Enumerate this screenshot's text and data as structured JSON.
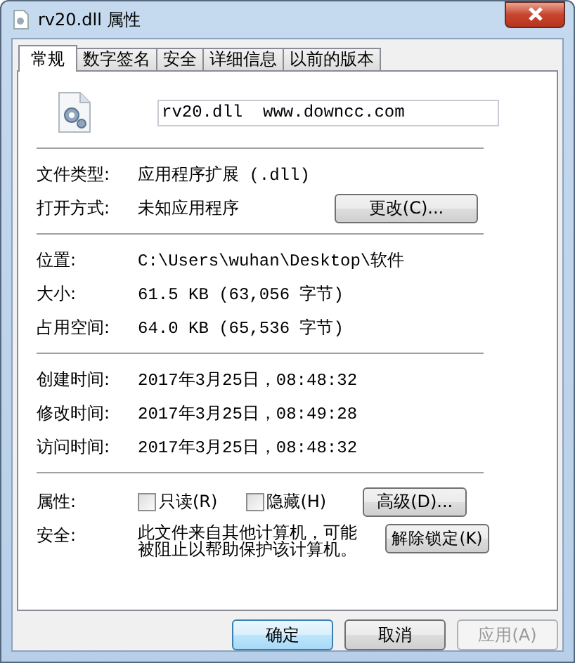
{
  "window": {
    "title": "rv20.dll 属性"
  },
  "tabs": [
    {
      "label": "常规",
      "selected": true
    },
    {
      "label": "数字签名",
      "selected": false
    },
    {
      "label": "安全",
      "selected": false
    },
    {
      "label": "详细信息",
      "selected": false
    },
    {
      "label": "以前的版本",
      "selected": false
    }
  ],
  "file_name": {
    "value": "rv20.dll  www.downcc.com"
  },
  "sections": [
    [
      {
        "label": "文件类型:",
        "value": "应用程序扩展 (.dll)"
      },
      {
        "label": "打开方式:",
        "value": "未知应用程序",
        "button": "更改(C)..."
      }
    ],
    [
      {
        "label": "位置:",
        "value": "C:\\Users\\wuhan\\Desktop\\软件"
      },
      {
        "label": "大小:",
        "value": "61.5 KB (63,056 字节)"
      },
      {
        "label": "占用空间:",
        "value": "64.0 KB (65,536 字节)"
      }
    ],
    [
      {
        "label": "创建时间:",
        "value": "2017年3月25日，08:48:32"
      },
      {
        "label": "修改时间:",
        "value": "2017年3月25日，08:49:28"
      },
      {
        "label": "访问时间:",
        "value": "2017年3月25日，08:48:32"
      }
    ]
  ],
  "attributes": {
    "label": "属性:",
    "checkboxes": [
      {
        "label": "只读(R)",
        "checked": false
      },
      {
        "label": "隐藏(H)",
        "checked": false
      }
    ],
    "button": "高级(D)..."
  },
  "security": {
    "label": "安全:",
    "text": "此文件来自其他计算机，可能被阻止以帮助保护该计算机。",
    "button": "解除锁定(K)"
  },
  "buttons": [
    {
      "label": "确定",
      "kind": "default",
      "disabled": false
    },
    {
      "label": "取消",
      "kind": "normal",
      "disabled": false
    },
    {
      "label": "应用(A)",
      "kind": "normal",
      "disabled": true
    }
  ]
}
